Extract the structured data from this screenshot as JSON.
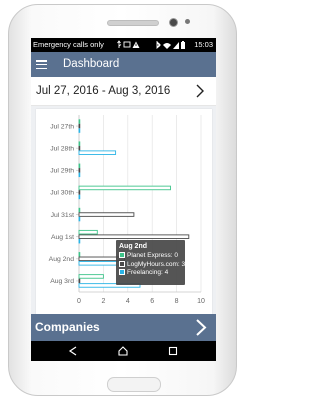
{
  "status_bar": {
    "carrier_text": "Emergency calls only",
    "time": "15:03",
    "icons": [
      "usb-icon",
      "image-icon",
      "warning-icon",
      "bluetooth-icon",
      "wifi-icon",
      "signal-icon",
      "battery-icon"
    ]
  },
  "app_bar": {
    "title": "Dashboard",
    "menu_icon": "hamburger-menu-icon"
  },
  "date_selector": {
    "range": "Jul 27, 2016 - Aug 3, 2016",
    "next_icon": "chevron-right-icon"
  },
  "chart_data": {
    "type": "bar",
    "orientation": "horizontal",
    "categories": [
      "Jul 27th",
      "Jul 28th",
      "Jul 29th",
      "Jul 30th",
      "Jul 31st",
      "Aug 1st",
      "Aug 2nd",
      "Aug 3rd"
    ],
    "series": [
      {
        "name": "Planet Express",
        "color": "#3fc48a",
        "values": [
          0,
          0,
          0,
          7.5,
          0,
          1.5,
          0,
          2
        ]
      },
      {
        "name": "LogMyHours.com",
        "color": "#4a4a4a",
        "values": [
          0,
          0,
          0,
          0,
          4.5,
          9,
          3.733,
          0
        ]
      },
      {
        "name": "Freelancing",
        "color": "#2bb4e6",
        "values": [
          0,
          3,
          0,
          0,
          0,
          0,
          4,
          5
        ]
      }
    ],
    "xlim": [
      0,
      10
    ],
    "xticks": [
      "0",
      "2",
      "4",
      "6",
      "8",
      "10"
    ],
    "grid": true,
    "legend": "none"
  },
  "tooltip": {
    "title": "Aug 2nd",
    "rows": [
      {
        "label": "Planet Express: 0",
        "color": "#3fc48a"
      },
      {
        "label": "LogMyHours.com: 3.733",
        "color": "#4a4a4a"
      },
      {
        "label": "Freelancing: 4",
        "color": "#2bb4e6"
      }
    ]
  },
  "companies": {
    "label": "Companies",
    "chevron_icon": "chevron-right-icon"
  },
  "nav_bar": {
    "buttons": [
      "back-icon",
      "home-icon",
      "recent-apps-icon"
    ]
  }
}
